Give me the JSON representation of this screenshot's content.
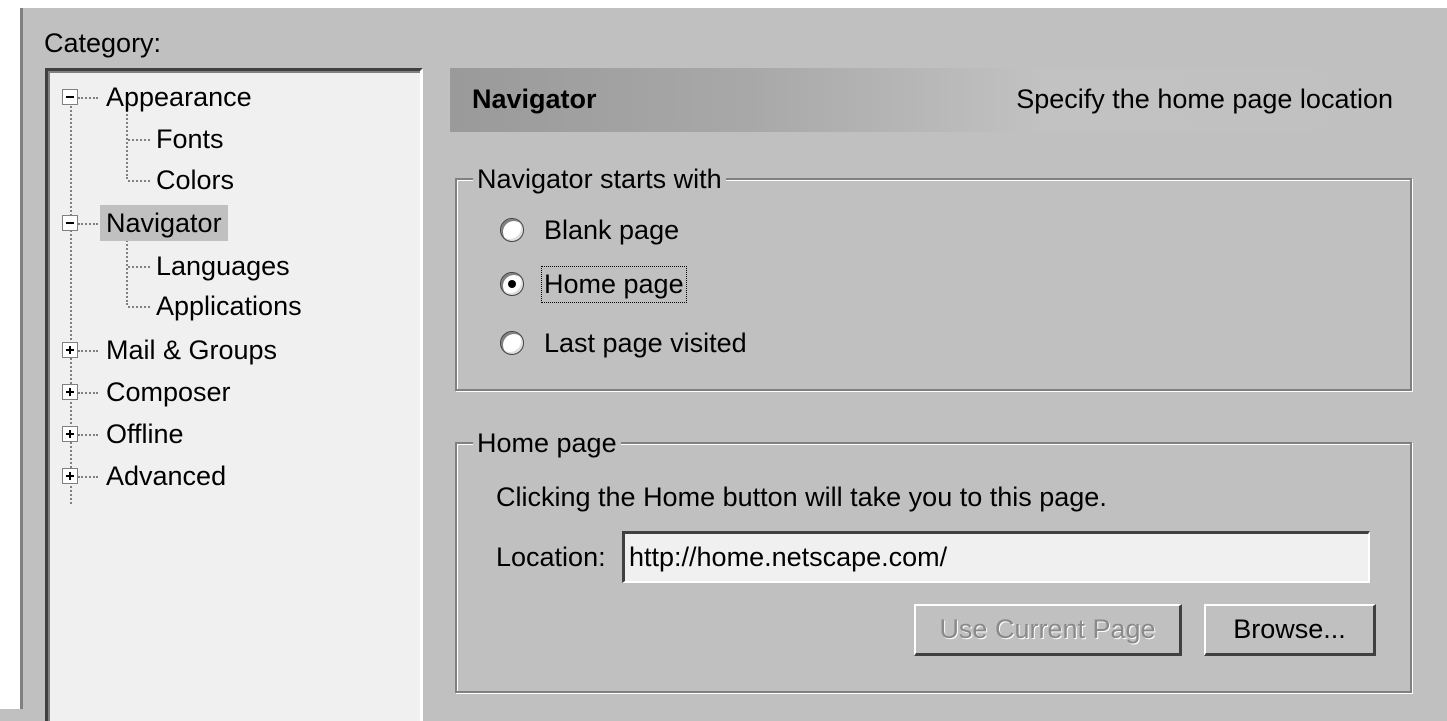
{
  "category": {
    "label": "Category:"
  },
  "tree": {
    "items": [
      {
        "label": "Appearance",
        "expander": "minus"
      },
      {
        "label": "Fonts"
      },
      {
        "label": "Colors"
      },
      {
        "label": "Navigator",
        "expander": "minus",
        "selected": true
      },
      {
        "label": "Languages"
      },
      {
        "label": "Applications"
      },
      {
        "label": "Mail & Groups",
        "expander": "plus"
      },
      {
        "label": "Composer",
        "expander": "plus"
      },
      {
        "label": "Offline",
        "expander": "plus"
      },
      {
        "label": "Advanced",
        "expander": "plus"
      }
    ]
  },
  "panel": {
    "title": "Navigator",
    "description": "Specify the home page location"
  },
  "starts_with": {
    "legend": "Navigator starts with",
    "options": [
      {
        "label": "Blank page",
        "checked": false
      },
      {
        "label": "Home page",
        "checked": true
      },
      {
        "label": "Last page visited",
        "checked": false
      }
    ]
  },
  "home_page": {
    "legend": "Home page",
    "description": "Clicking the Home button will take you to this page.",
    "location_label": "Location:",
    "location_value": "http://home.netscape.com/",
    "use_current_label": "Use Current Page",
    "browse_label": "Browse..."
  }
}
